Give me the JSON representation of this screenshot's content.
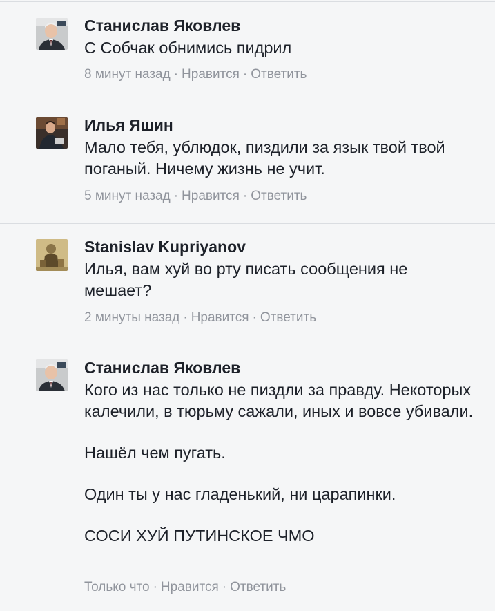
{
  "comments": [
    {
      "author": "Станислав Яковлев",
      "paragraphs": [
        "С Собчак обнимись пидрил"
      ],
      "time": "8 минут назад",
      "like": "Нравится",
      "reply": "Ответить",
      "avatar_icon": "avatar-man-suit-icon"
    },
    {
      "author": "Илья Яшин",
      "paragraphs": [
        "Мало тебя, ублюдок, пиздили за язык твой твой поганый. Ничему жизнь не учит."
      ],
      "time": "5 минут назад",
      "like": "Нравится",
      "reply": "Ответить",
      "avatar_icon": "avatar-man-dark-icon"
    },
    {
      "author": "Stanislav Kupriyanov",
      "paragraphs": [
        "Илья, вам хуй во рту писать сообщения не мешает?"
      ],
      "time": "2 минуты назад",
      "like": "Нравится",
      "reply": "Ответить",
      "avatar_icon": "avatar-sepia-photo-icon"
    },
    {
      "author": "Станислав Яковлев",
      "paragraphs": [
        "Кого из нас только не пиздли за правду. Некоторых калечили, в тюрьму сажали, иных и вовсе убивали.",
        "Нашёл чем пугать.",
        "Один ты у нас гладенький, ни царапинки.",
        "СОСИ ХУЙ ПУТИНСКОЕ ЧМО"
      ],
      "time": "Только что",
      "like": "Нравится",
      "reply": "Ответить",
      "avatar_icon": "avatar-man-suit-icon"
    }
  ],
  "separator": "·",
  "colors": {
    "background": "#f5f6f7",
    "text": "#1d2129",
    "meta": "#90949c",
    "divider": "#dadde1"
  }
}
